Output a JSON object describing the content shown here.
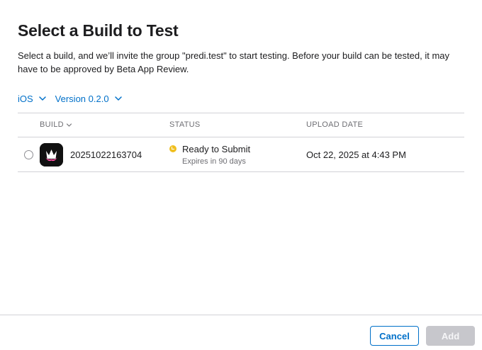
{
  "dialog": {
    "title": "Select a Build to Test",
    "description": "Select a build, and we’ll invite the group \"predi.test\" to start testing. Before your build can be tested, it may have to be approved by Beta App Review."
  },
  "filters": {
    "platform": "iOS",
    "version": "Version 0.2.0"
  },
  "table": {
    "columns": {
      "build": "BUILD",
      "status": "STATUS",
      "upload_date": "UPLOAD DATE"
    },
    "rows": [
      {
        "build": "20251022163704",
        "status": "Ready to Submit",
        "status_detail": "Expires in 90 days",
        "upload_date": "Oct 22, 2025 at 4:43 PM",
        "selected": false
      }
    ]
  },
  "footer": {
    "cancel_label": "Cancel",
    "add_label": "Add"
  },
  "colors": {
    "accent": "#0070c9",
    "status_ready": "#f0bf1f",
    "disabled_button": "#c7c7cc"
  },
  "icons": {
    "dropdown": "chevron-down-icon",
    "sort": "chevron-down-icon",
    "status": "checkmark-circle-icon",
    "app": "app-icon"
  }
}
